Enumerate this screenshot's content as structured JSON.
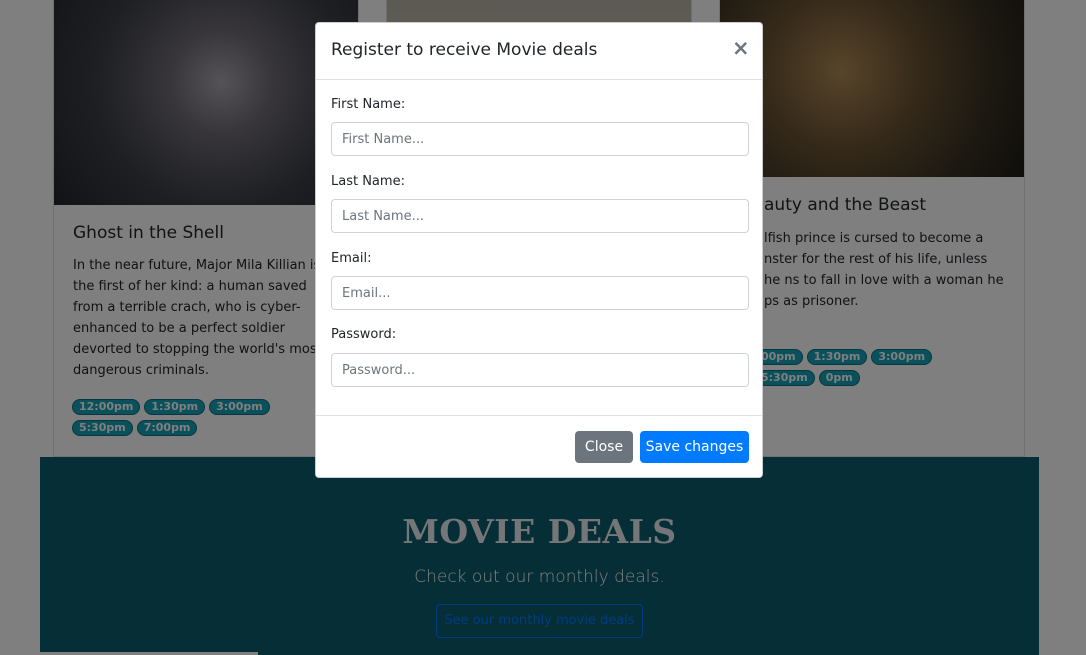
{
  "cards": [
    {
      "title": "Ghost in the Shell",
      "text": "In the near future, Major Mila Killian is the first of her kind: a human saved from a terrible crach, who is cyber-enhanced to be a perfect soldier devorted to stopping the world's most dangerous criminals.",
      "times": [
        "12:00pm",
        "1:30pm",
        "3:00pm",
        "5:30pm",
        "7:00pm"
      ]
    },
    {
      "title": "auty and the Beast",
      "text": "lfish prince is cursed to become a nster for the rest of his life, unless he ns to fall in love with a woman he ps as prisoner.",
      "times": [
        "00pm",
        "1:30pm",
        "3:00pm",
        "5:30pm",
        "0pm"
      ]
    }
  ],
  "deals": {
    "title": "MOVIE DEALS",
    "subtitle": "Check out our monthly deals.",
    "button": "See our monthly movie deals"
  },
  "modal": {
    "title": "Register to receive Movie deals",
    "close_icon": "×",
    "fields": [
      {
        "label": "First Name:",
        "placeholder": "First Name..."
      },
      {
        "label": "Last Name:",
        "placeholder": "Last Name..."
      },
      {
        "label": "Email:",
        "placeholder": "Email..."
      },
      {
        "label": "Password:",
        "placeholder": "Password..."
      }
    ],
    "close_button": "Close",
    "save_button": "Save changes"
  },
  "colors": {
    "primary": "#007bff",
    "secondary": "#6c757d",
    "info": "#17a2b8",
    "deals_bg": "#0a5c6e"
  }
}
